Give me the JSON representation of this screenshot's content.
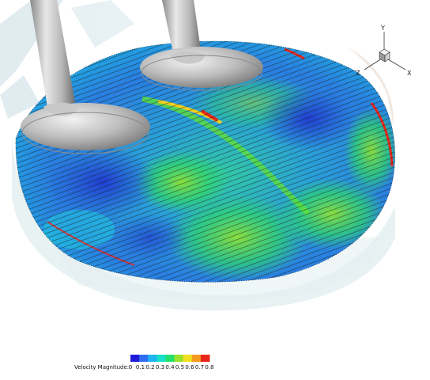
{
  "axes": {
    "x": "X",
    "y": "Y",
    "z": "Z"
  },
  "legend": {
    "label": "Velocity Magnitude:",
    "ticks": [
      "0",
      "0.1",
      "0.2",
      "0.3",
      "0.4",
      "0.5",
      "0.6",
      "0.7",
      "0.8"
    ],
    "colors": [
      "#1f1bd6",
      "#2f6cf0",
      "#1fb5f0",
      "#18e0c8",
      "#23e06a",
      "#9be02a",
      "#f0e020",
      "#f59a1e",
      "#e8261a"
    ]
  }
}
